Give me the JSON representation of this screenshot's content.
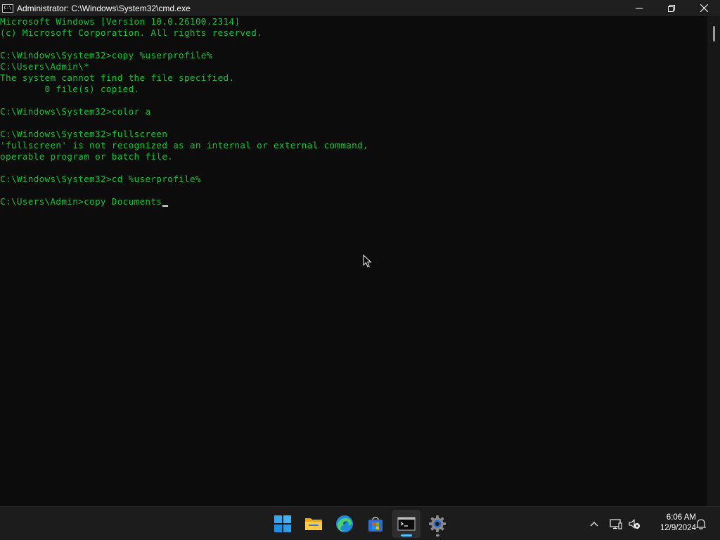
{
  "window": {
    "title": "Administrator: C:\\Windows\\System32\\cmd.exe",
    "icon_text": "C:\\",
    "controls": [
      "minimize-icon",
      "maximize-icon",
      "close-icon"
    ]
  },
  "console": {
    "text_color": "#13c13a",
    "background": "#0c0c0c",
    "lines": [
      "Microsoft Windows [Version 10.0.26100.2314]",
      "(c) Microsoft Corporation. All rights reserved.",
      "",
      "C:\\Windows\\System32>copy %userprofile%",
      "C:\\Users\\Admin\\*",
      "The system cannot find the file specified.",
      "        0 file(s) copied.",
      "",
      "C:\\Windows\\System32>color a",
      "",
      "C:\\Windows\\System32>fullscreen",
      "'fullscreen' is not recognized as an internal or external command,",
      "operable program or batch file.",
      "",
      "C:\\Windows\\System32>cd %userprofile%",
      "",
      "C:\\Users\\Admin>copy Documents"
    ]
  },
  "taskbar": {
    "apps": [
      {
        "name": "start-icon",
        "active": false,
        "running": false
      },
      {
        "name": "file-explorer-icon",
        "active": false,
        "running": false
      },
      {
        "name": "edge-icon",
        "active": false,
        "running": false
      },
      {
        "name": "store-icon",
        "active": false,
        "running": false
      },
      {
        "name": "terminal-icon",
        "active": true,
        "running": true
      },
      {
        "name": "settings-icon",
        "active": false,
        "running": true
      }
    ],
    "tray_icons": [
      "chevron-up-icon",
      "network-icon",
      "volume-muted-icon",
      "notification-bell-icon"
    ],
    "clock": {
      "time": "6:06 AM",
      "date": "12/9/2024"
    }
  }
}
